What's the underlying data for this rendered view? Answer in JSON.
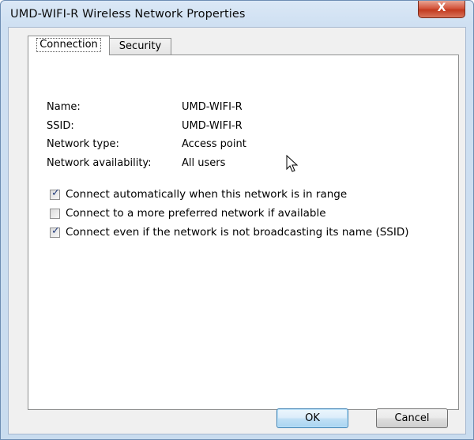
{
  "window": {
    "title": "UMD-WIFI-R Wireless Network Properties",
    "close_glyph": "X"
  },
  "tabs": [
    {
      "label": "Connection",
      "selected": true
    },
    {
      "label": "Security",
      "selected": false
    }
  ],
  "info": [
    {
      "label": "Name:",
      "value": "UMD-WIFI-R"
    },
    {
      "label": "SSID:",
      "value": "UMD-WIFI-R"
    },
    {
      "label": "Network type:",
      "value": "Access point"
    },
    {
      "label": "Network availability:",
      "value": "All users"
    }
  ],
  "options": [
    {
      "label": "Connect automatically when this network is in range",
      "checked": true
    },
    {
      "label": "Connect to a more preferred network if available",
      "checked": false
    },
    {
      "label": "Connect even if the network is not broadcasting its name (SSID)",
      "checked": true
    }
  ],
  "buttons": {
    "ok": "OK",
    "cancel": "Cancel"
  },
  "icons": {
    "close": "close-icon",
    "cursor": "mouse-pointer-icon",
    "check": "checkmark-icon"
  },
  "colors": {
    "titlebar": "#cfe0f2",
    "close_button": "#c94a30",
    "ok_button_border": "#3c7fb1",
    "checkmark": "#27407e"
  }
}
